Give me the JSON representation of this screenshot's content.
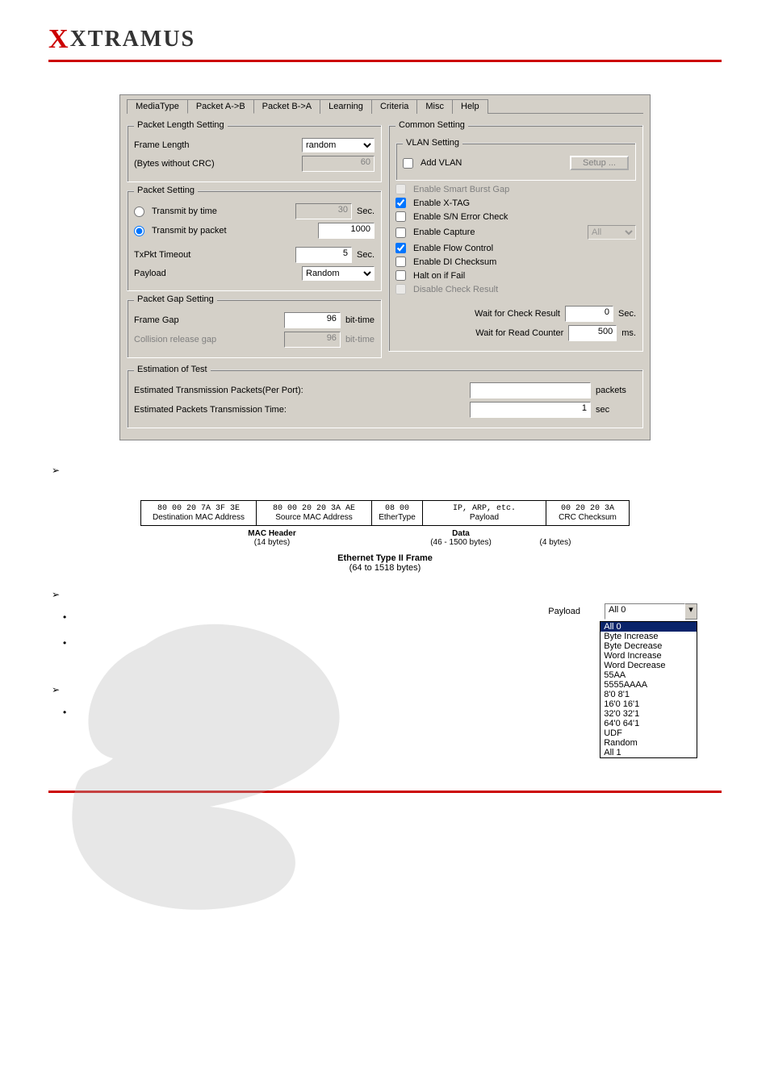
{
  "brand": "XTRAMUS",
  "tabs": [
    "MediaType",
    "Packet A->B",
    "Packet B->A",
    "Learning",
    "Criteria",
    "Misc",
    "Help"
  ],
  "active_tab": "Packet A->B",
  "dialog": {
    "packet_length": {
      "legend": "Packet Length Setting",
      "frame_length_lbl": "Frame Length",
      "frame_length_mode": "random",
      "bytes_lbl": "(Bytes without CRC)",
      "bytes_val": "60"
    },
    "packet_setting": {
      "legend": "Packet Setting",
      "by_time_lbl": "Transmit by time",
      "by_time_val": "30",
      "by_time_unit": "Sec.",
      "by_packet_lbl": "Transmit by packet",
      "by_packet_val": "1000",
      "timeout_lbl": "TxPkt Timeout",
      "timeout_val": "5",
      "timeout_unit": "Sec.",
      "payload_lbl": "Payload",
      "payload_val": "Random"
    },
    "gap": {
      "legend": "Packet Gap Setting",
      "frame_gap_lbl": "Frame Gap",
      "frame_gap_val": "96",
      "frame_gap_unit": "bit-time",
      "collision_lbl": "Collision release gap",
      "collision_val": "96",
      "collision_unit": "bit-time"
    },
    "common": {
      "legend": "Common Setting",
      "vlan_legend": "VLAN Setting",
      "add_vlan": "Add VLAN",
      "setup_btn": "Setup ...",
      "opts": {
        "smart_burst": "Enable Smart Burst Gap",
        "xtag": "Enable X-TAG",
        "sn_err": "Enable S/N Error Check",
        "capture": "Enable Capture",
        "capture_sel": "All",
        "flow": "Enable Flow Control",
        "di": "Enable DI Checksum",
        "halt": "Halt on if Fail",
        "disable_check": "Disable Check Result"
      },
      "wait_check_lbl": "Wait for Check Result",
      "wait_check_val": "0",
      "wait_check_unit": "Sec.",
      "wait_read_lbl": "Wait for Read Counter",
      "wait_read_val": "500",
      "wait_read_unit": "ms."
    },
    "estimation": {
      "legend": "Estimation of Test",
      "pkts_lbl": "Estimated Transmission Packets(Per Port):",
      "pkts_val": "",
      "pkts_unit": "packets",
      "time_lbl": "Estimated Packets Transmission Time:",
      "time_val": "1",
      "time_unit": "sec"
    }
  },
  "frame": {
    "dest_hex": "80 00 20 7A 3F 3E",
    "dest_lbl": "Destination MAC Address",
    "src_hex": "80 00 20 20 3A AE",
    "src_lbl": "Source MAC Address",
    "etype_hex": "08 00",
    "etype_lbl": "EtherType",
    "payload_hex": "IP, ARP, etc.",
    "payload_lbl": "Payload",
    "crc_hex": "00 20 20 3A",
    "crc_lbl": "CRC Checksum",
    "mac_header": "MAC Header",
    "mac_bytes": "(14 bytes)",
    "data_lbl": "Data",
    "data_bytes": "(46 - 1500 bytes)",
    "crc_bytes": "(4 bytes)",
    "title": "Ethernet Type II Frame",
    "title_bytes": "(64 to 1518 bytes)"
  },
  "payload_dd": {
    "label": "Payload",
    "selected": "All 0",
    "options": [
      "All 0",
      "Byte Increase",
      "Byte Decrease",
      "Word Increase",
      "Word Decrease",
      "55AA",
      "5555AAAA",
      "8'0 8'1",
      "16'0 16'1",
      "32'0 32'1",
      "64'0 64'1",
      "UDF",
      "Random",
      "All 1"
    ]
  }
}
